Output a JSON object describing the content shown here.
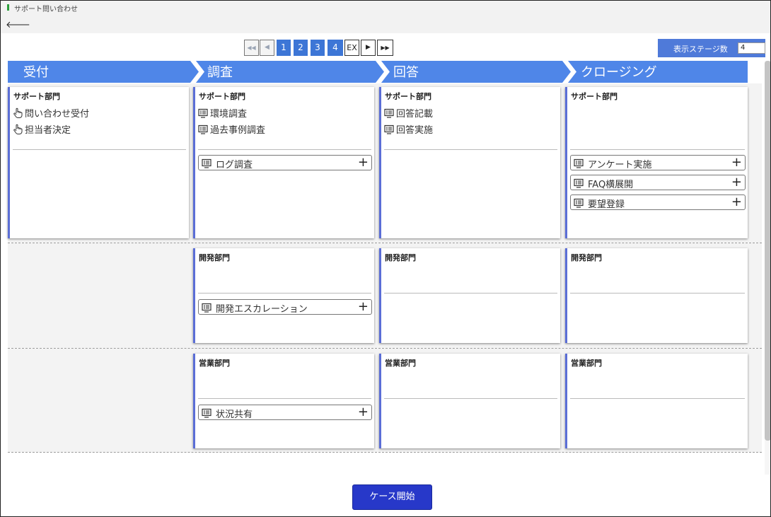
{
  "window": {
    "title": "サポート問い合わせ"
  },
  "nav": {
    "back_icon": "back-arrow-icon",
    "back_glyph": "🡐"
  },
  "pager": {
    "first_glyph": "◀◀",
    "prev_glyph": "◀",
    "pages": [
      "1",
      "2",
      "3",
      "4"
    ],
    "ex_label": "EX",
    "next_glyph": "▶",
    "last_glyph": "▶▶"
  },
  "stage_count": {
    "label": "表示ステージ数",
    "value": "4"
  },
  "stages": [
    "受付",
    "調査",
    "回答",
    "クロージング"
  ],
  "lanes": [
    {
      "cards": [
        {
          "dept": "サポート部門",
          "activities": [
            "問い合わせ受付",
            "担当者決定"
          ],
          "activity_icon": "hand-pointer-icon",
          "options": []
        },
        {
          "dept": "サポート部門",
          "activities": [
            "環境調査",
            "過去事例調査"
          ],
          "activity_icon": "screen-icon",
          "options": [
            "ログ調査"
          ]
        },
        {
          "dept": "サポート部門",
          "activities": [
            "回答記載",
            "回答実施"
          ],
          "activity_icon": "screen-icon",
          "options": []
        },
        {
          "dept": "サポート部門",
          "activities": [],
          "activity_icon": "screen-icon",
          "options": [
            "アンケート実施",
            "FAQ横展開",
            "要望登録"
          ]
        }
      ]
    },
    {
      "cards": [
        {
          "dept": "開発部門",
          "activities": [],
          "options": [
            "開発エスカレーション"
          ]
        },
        {
          "dept": "開発部門",
          "activities": [],
          "options": []
        },
        {
          "dept": "開発部門",
          "activities": [],
          "options": []
        }
      ]
    },
    {
      "cards": [
        {
          "dept": "営業部門",
          "activities": [],
          "options": [
            "状況共有"
          ]
        },
        {
          "dept": "営業部門",
          "activities": [],
          "options": []
        },
        {
          "dept": "営業部門",
          "activities": [],
          "options": []
        }
      ]
    }
  ],
  "actions": {
    "start_label": "ケース開始"
  },
  "colors": {
    "stage_bar": "#4f86e8",
    "page_active": "#3d76d6",
    "card_accent": "#5b6ed6",
    "start_button": "#2738c9",
    "title_mark": "#2a9d3a"
  }
}
